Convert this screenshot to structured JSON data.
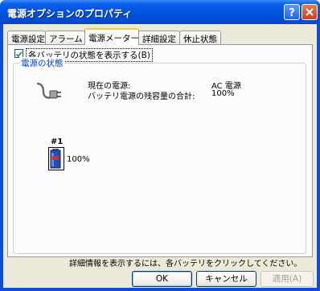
{
  "window": {
    "title": "電源オプションのプロパティ"
  },
  "tabs": [
    {
      "label": "電源設定"
    },
    {
      "label": "アラーム"
    },
    {
      "label": "電源メーター"
    },
    {
      "label": "詳細設定"
    },
    {
      "label": "休止状態"
    }
  ],
  "active_tab": "電源メーター",
  "show_battery_checkbox": {
    "label": "各バッテリの状態を表示する(B)",
    "checked": true
  },
  "power_status": {
    "group_label": "電源の状態",
    "current_source_label": "現在の電源:",
    "current_source_value": "AC 電源",
    "total_remaining_label": "バッテリ電源の残容量の合計:",
    "total_remaining_value": "100%"
  },
  "battery": {
    "number": "#1",
    "percent": "100%",
    "level": 1.0
  },
  "info_text": "詳細情報を表示するには、各バッテリをクリックしてください。",
  "buttons": {
    "ok": "OK",
    "cancel": "キャンセル",
    "apply": "適用(A)"
  },
  "colors": {
    "title_bar": "#0052e0",
    "group_label": "#0046d5",
    "tab_highlight": "#ffc83c",
    "battery_fill": "#1f4fb4"
  }
}
